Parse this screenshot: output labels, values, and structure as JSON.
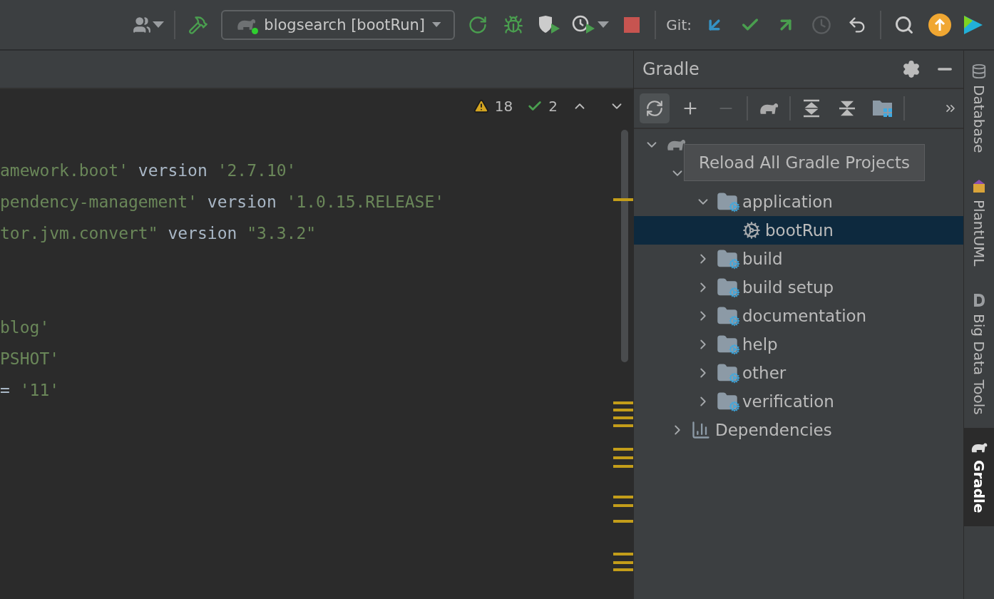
{
  "toolbar": {
    "run_config": {
      "label": "blogsearch [bootRun]",
      "running": true
    },
    "git_label": "Git:"
  },
  "editor": {
    "warnings": "18",
    "weak_warnings": "2",
    "lines": [
      {
        "kind": "code",
        "tokens": [
          {
            "kind": "string",
            "text": "amework.boot'"
          },
          {
            "kind": "plain",
            "text": " version "
          },
          {
            "kind": "string",
            "text": "'2.7.10'"
          }
        ]
      },
      {
        "kind": "code",
        "tokens": [
          {
            "kind": "string",
            "text": "pendency-management'"
          },
          {
            "kind": "plain",
            "text": " version "
          },
          {
            "kind": "string",
            "text": "'1.0.15.RELEASE'"
          }
        ]
      },
      {
        "kind": "code",
        "tokens": [
          {
            "kind": "string",
            "text": "tor.jvm.convert\""
          },
          {
            "kind": "plain",
            "text": " version "
          },
          {
            "kind": "string",
            "text": "\"3.3.2\""
          }
        ]
      },
      {
        "kind": "blank"
      },
      {
        "kind": "blank"
      },
      {
        "kind": "code",
        "tokens": [
          {
            "kind": "string",
            "text": "blog'"
          }
        ]
      },
      {
        "kind": "code",
        "tokens": [
          {
            "kind": "string",
            "text": "PSHOT'"
          }
        ]
      },
      {
        "kind": "code",
        "tokens": [
          {
            "kind": "plain",
            "text": "="
          },
          {
            "kind": "string",
            "text": " '11'"
          }
        ]
      }
    ]
  },
  "gradle": {
    "title": "Gradle",
    "tooltip": "Reload All Gradle Projects",
    "tree": [
      {
        "kind": "project",
        "expanded": true,
        "selected": false,
        "children": [
          {
            "kind": "hidden",
            "expanded": true,
            "selected": false,
            "children": [
              {
                "kind": "task_group",
                "label": "application",
                "expanded": true,
                "selected": false,
                "children": [
                  {
                    "kind": "task",
                    "label": "bootRun",
                    "selected": true
                  }
                ]
              },
              {
                "kind": "task_group",
                "label": "build",
                "expanded": false,
                "selected": false
              },
              {
                "kind": "task_group",
                "label": "build setup",
                "expanded": false,
                "selected": false
              },
              {
                "kind": "task_group",
                "label": "documentation",
                "expanded": false,
                "selected": false
              },
              {
                "kind": "task_group",
                "label": "help",
                "expanded": false,
                "selected": false
              },
              {
                "kind": "task_group",
                "label": "other",
                "expanded": false,
                "selected": false
              },
              {
                "kind": "task_group",
                "label": "verification",
                "expanded": false,
                "selected": false
              }
            ]
          },
          {
            "kind": "dependencies",
            "label": "Dependencies",
            "expanded": false,
            "selected": false
          }
        ]
      }
    ]
  },
  "side_tabs": [
    {
      "kind": "database",
      "label": "Database",
      "selected": false
    },
    {
      "kind": "plantuml",
      "label": "PlantUML",
      "selected": false
    },
    {
      "kind": "bigdata",
      "label": "Big Data Tools",
      "selected": false
    },
    {
      "kind": "gradle",
      "label": "Gradle",
      "selected": true
    }
  ]
}
